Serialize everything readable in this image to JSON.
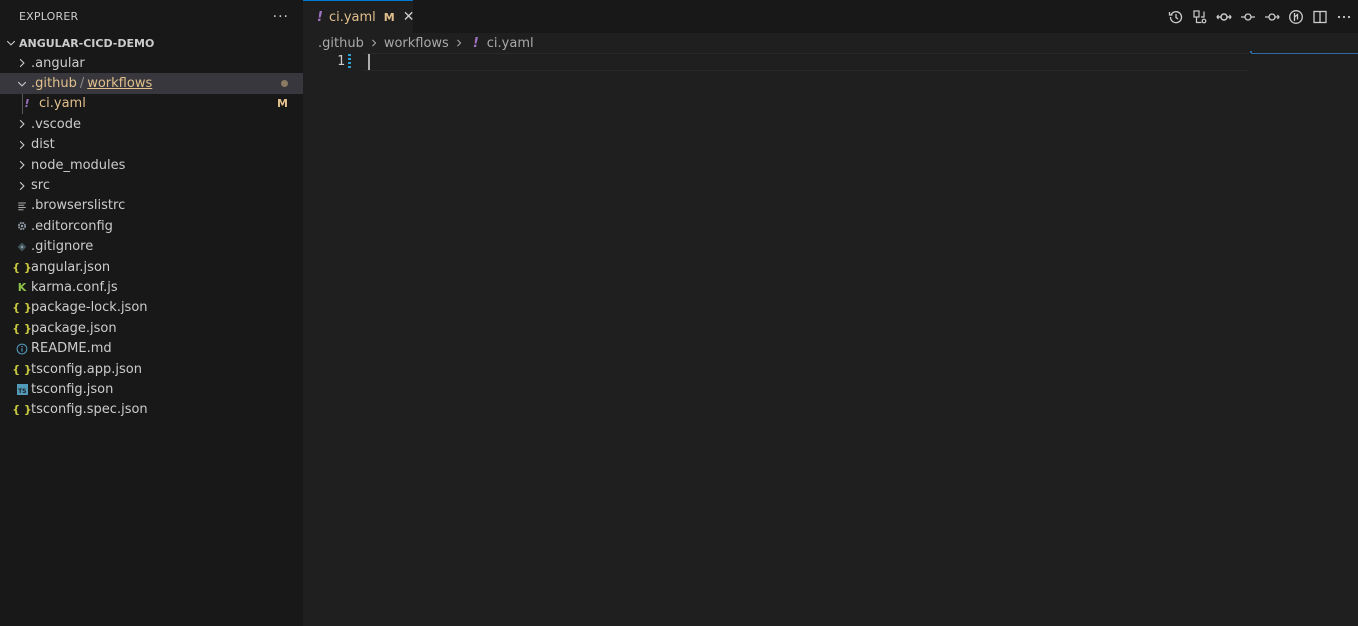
{
  "explorer": {
    "title": "EXPLORER",
    "more": "···",
    "root_folder": "ANGULAR-CICD-DEMO",
    "items": [
      {
        "label": ".angular",
        "kind": "folder"
      },
      {
        "label_a": ".github",
        "sep": "/",
        "label_b": "workflows",
        "kind": "folder-open"
      },
      {
        "label": "ci.yaml",
        "kind": "file",
        "badge": "M"
      },
      {
        "label": ".vscode",
        "kind": "folder"
      },
      {
        "label": "dist",
        "kind": "folder"
      },
      {
        "label": "node_modules",
        "kind": "folder"
      },
      {
        "label": "src",
        "kind": "folder"
      },
      {
        "label": ".browserslistrc",
        "kind": "file"
      },
      {
        "label": ".editorconfig",
        "kind": "file"
      },
      {
        "label": ".gitignore",
        "kind": "file"
      },
      {
        "label": "angular.json",
        "kind": "file"
      },
      {
        "label": "karma.conf.js",
        "kind": "file"
      },
      {
        "label": "package-lock.json",
        "kind": "file"
      },
      {
        "label": "package.json",
        "kind": "file"
      },
      {
        "label": "README.md",
        "kind": "file"
      },
      {
        "label": "tsconfig.app.json",
        "kind": "file"
      },
      {
        "label": "tsconfig.json",
        "kind": "file"
      },
      {
        "label": "tsconfig.spec.json",
        "kind": "file"
      }
    ]
  },
  "icons": {
    "yaml": "!",
    "json": "{ }",
    "karma": "K",
    "ts": "TS",
    "info": "i"
  },
  "tab": {
    "label": "ci.yaml",
    "badge": "M",
    "close": "✕"
  },
  "breadcrumbs": {
    "part1": ".github",
    "part2": "workflows",
    "part3": "ci.yaml"
  },
  "editor": {
    "line_number": "1"
  },
  "colors": {
    "modified": "#e2c08d",
    "yaml_icon": "#a074c4",
    "json_icon": "#cbcb41",
    "accent": "#0078d4"
  }
}
